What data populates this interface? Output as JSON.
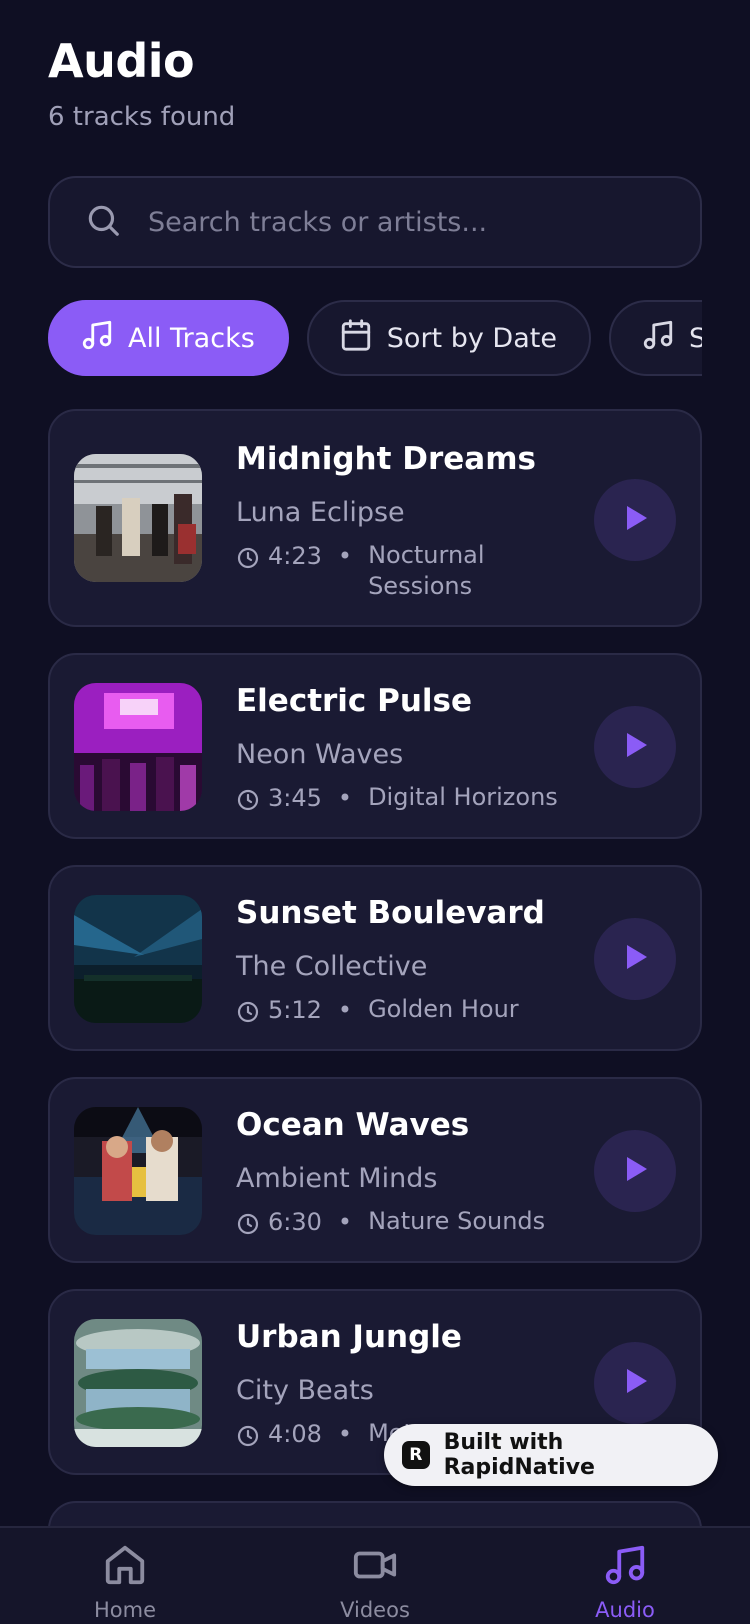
{
  "header": {
    "title": "Audio",
    "subtitle": "6 tracks found"
  },
  "search": {
    "placeholder": "Search tracks or artists..."
  },
  "filters": [
    {
      "label": "All Tracks",
      "icon": "music-note-icon",
      "active": true
    },
    {
      "label": "Sort by Date",
      "icon": "calendar-icon",
      "active": false
    },
    {
      "label": "So",
      "icon": "music-note-icon",
      "active": false
    }
  ],
  "tracks": [
    {
      "title": "Midnight Dreams",
      "artist": "Luna Eclipse",
      "duration": "4:23",
      "album": "Nocturnal Sessions"
    },
    {
      "title": "Electric Pulse",
      "artist": "Neon Waves",
      "duration": "3:45",
      "album": "Digital Horizons"
    },
    {
      "title": "Sunset Boulevard",
      "artist": "The Collective",
      "duration": "5:12",
      "album": "Golden Hour"
    },
    {
      "title": "Ocean Waves",
      "artist": "Ambient Minds",
      "duration": "6:30",
      "album": "Nature Sounds"
    },
    {
      "title": "Urban Jungle",
      "artist": "City Beats",
      "duration": "4:08",
      "album": "Met"
    }
  ],
  "meta_separator": "•",
  "badge": {
    "logo": "R",
    "text": "Built with RapidNative"
  },
  "tabs": [
    {
      "label": "Home",
      "icon": "home-icon",
      "active": false
    },
    {
      "label": "Videos",
      "icon": "video-camera-icon",
      "active": false
    },
    {
      "label": "Audio",
      "icon": "music-note-icon",
      "active": true
    }
  ],
  "colors": {
    "background": "#0f0f23",
    "card": "#1a1a33",
    "accent": "#8b5cf6",
    "muted": "#a4a4bc"
  }
}
